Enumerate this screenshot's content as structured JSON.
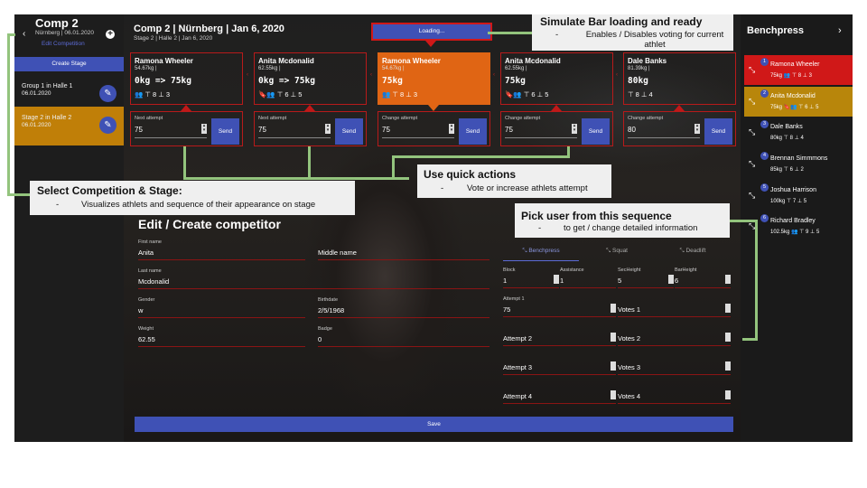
{
  "left_sidebar": {
    "title": "Comp 2",
    "subtitle": "Nürnberg | 06.01.2020",
    "back_icon": "chevron-left-icon",
    "add_icon": "plus-circle-icon",
    "edit_competition": "Edit Competition",
    "create_stage": "Create Stage",
    "stages": [
      {
        "name": "Group 1 in Halle 1",
        "date": "06.01.2020",
        "selected": false
      },
      {
        "name": "Stage 2 in Halle 2",
        "date": "06.01.2020",
        "selected": true
      }
    ]
  },
  "header": {
    "title": "Comp 2 | Nürnberg | Jan 6, 2020",
    "subtitle": "Stage 2 | Halle 2 | Jan 6, 2020",
    "loading_button": "Loading..."
  },
  "athletes": [
    {
      "name": "Ramona Wheeler",
      "weight": "54.67kg |",
      "attempt": "0kg => 75kg",
      "icons": "👥 ⊤ 8 ⊥ 3",
      "active": false,
      "box_label": "Next attempt",
      "box_value": "75",
      "send": "Send"
    },
    {
      "name": "Anita Mcdonalid",
      "weight": "62.55kg |",
      "attempt": "0kg => 75kg",
      "icons": "🔖👥 ⊤ 6 ⊥ 5",
      "active": false,
      "box_label": "Next attempt",
      "box_value": "75",
      "send": "Send"
    },
    {
      "name": "Ramona Wheeler",
      "weight": "54.67kg |",
      "attempt": "75kg",
      "icons": "👥 ⊤ 8 ⊥ 3",
      "active": true,
      "box_label": "Change attempt",
      "box_value": "75",
      "send": "Send"
    },
    {
      "name": "Anita Mcdonalid",
      "weight": "62.55kg |",
      "attempt": "75kg",
      "icons": "🔖👥 ⊤ 6 ⊥ 5",
      "active": false,
      "box_label": "Change attempt",
      "box_value": "75",
      "send": "Send"
    },
    {
      "name": "Dale Banks",
      "weight": "81.39kg |",
      "attempt": "80kg",
      "icons": "⊤ 8 ⊥ 4",
      "active": false,
      "box_label": "Change attempt",
      "box_value": "80",
      "send": "Send"
    }
  ],
  "form": {
    "title": "Edit / Create competitor",
    "first_name_label": "First name",
    "first_name": "Anita",
    "middle_name_label": "Middle name",
    "middle_name": "",
    "last_name_label": "Last name",
    "last_name": "Mcdonalid",
    "gender_label": "Gender",
    "gender": "w",
    "birthdate_label": "Birthdate",
    "birthdate": "2/5/1968",
    "weight_label": "Weight",
    "weight": "62.55",
    "badge_label": "Badge",
    "badge": "0",
    "tabs": [
      "Benchpress",
      "Squat",
      "Deadlift"
    ],
    "block_label": "Block",
    "block": "1",
    "assistance_label": "Assistance",
    "assistance": "1",
    "secheight_label": "SecHeight",
    "secheight": "5",
    "barheight_label": "BarHeight",
    "barheight": "6",
    "attempt1_label": "Attempt 1",
    "attempt1": "75",
    "votes1": "Votes 1",
    "attempt2": "Attempt 2",
    "votes2": "Votes 2",
    "attempt3": "Attempt 3",
    "votes3": "Votes 3",
    "attempt4": "Attempt 4",
    "votes4": "Votes 4",
    "save": "Save"
  },
  "right_sidebar": {
    "title": "Benchpress",
    "queue": [
      {
        "num": "1",
        "name": "Ramona Wheeler",
        "detail": "75kg 👥 ⊤ 8 ⊥ 3",
        "color": "#d01818"
      },
      {
        "num": "2",
        "name": "Anita Mcdonalid",
        "detail": "75kg 🔖👥 ⊤ 6 ⊥ 5",
        "color": "#b8860b"
      },
      {
        "num": "3",
        "name": "Dale Banks",
        "detail": "80kg ⊤ 8 ⊥ 4",
        "color": ""
      },
      {
        "num": "4",
        "name": "Brennan Simmmons",
        "detail": "85kg ⊤ 6 ⊥ 2",
        "color": ""
      },
      {
        "num": "5",
        "name": "Joshua Harrison",
        "detail": "100kg ⊤ 7 ⊥ 5",
        "color": ""
      },
      {
        "num": "6",
        "name": "Richard Bradley",
        "detail": "102.5kg 👥 ⊤ 9 ⊥ 5",
        "color": ""
      }
    ]
  },
  "annotations": {
    "bar": {
      "heading": "Simulate Bar loading and ready",
      "body": "Enables / Disables voting for current athlet"
    },
    "competition": {
      "heading": "Select Competition & Stage:",
      "body": "Visualizes athlets and sequence of their appearance on stage"
    },
    "quick": {
      "heading": "Use quick actions",
      "body": "Vote or increase athlets attempt"
    },
    "pick": {
      "heading": "Pick user from this sequence",
      "body": "to get / change detailed information"
    }
  }
}
